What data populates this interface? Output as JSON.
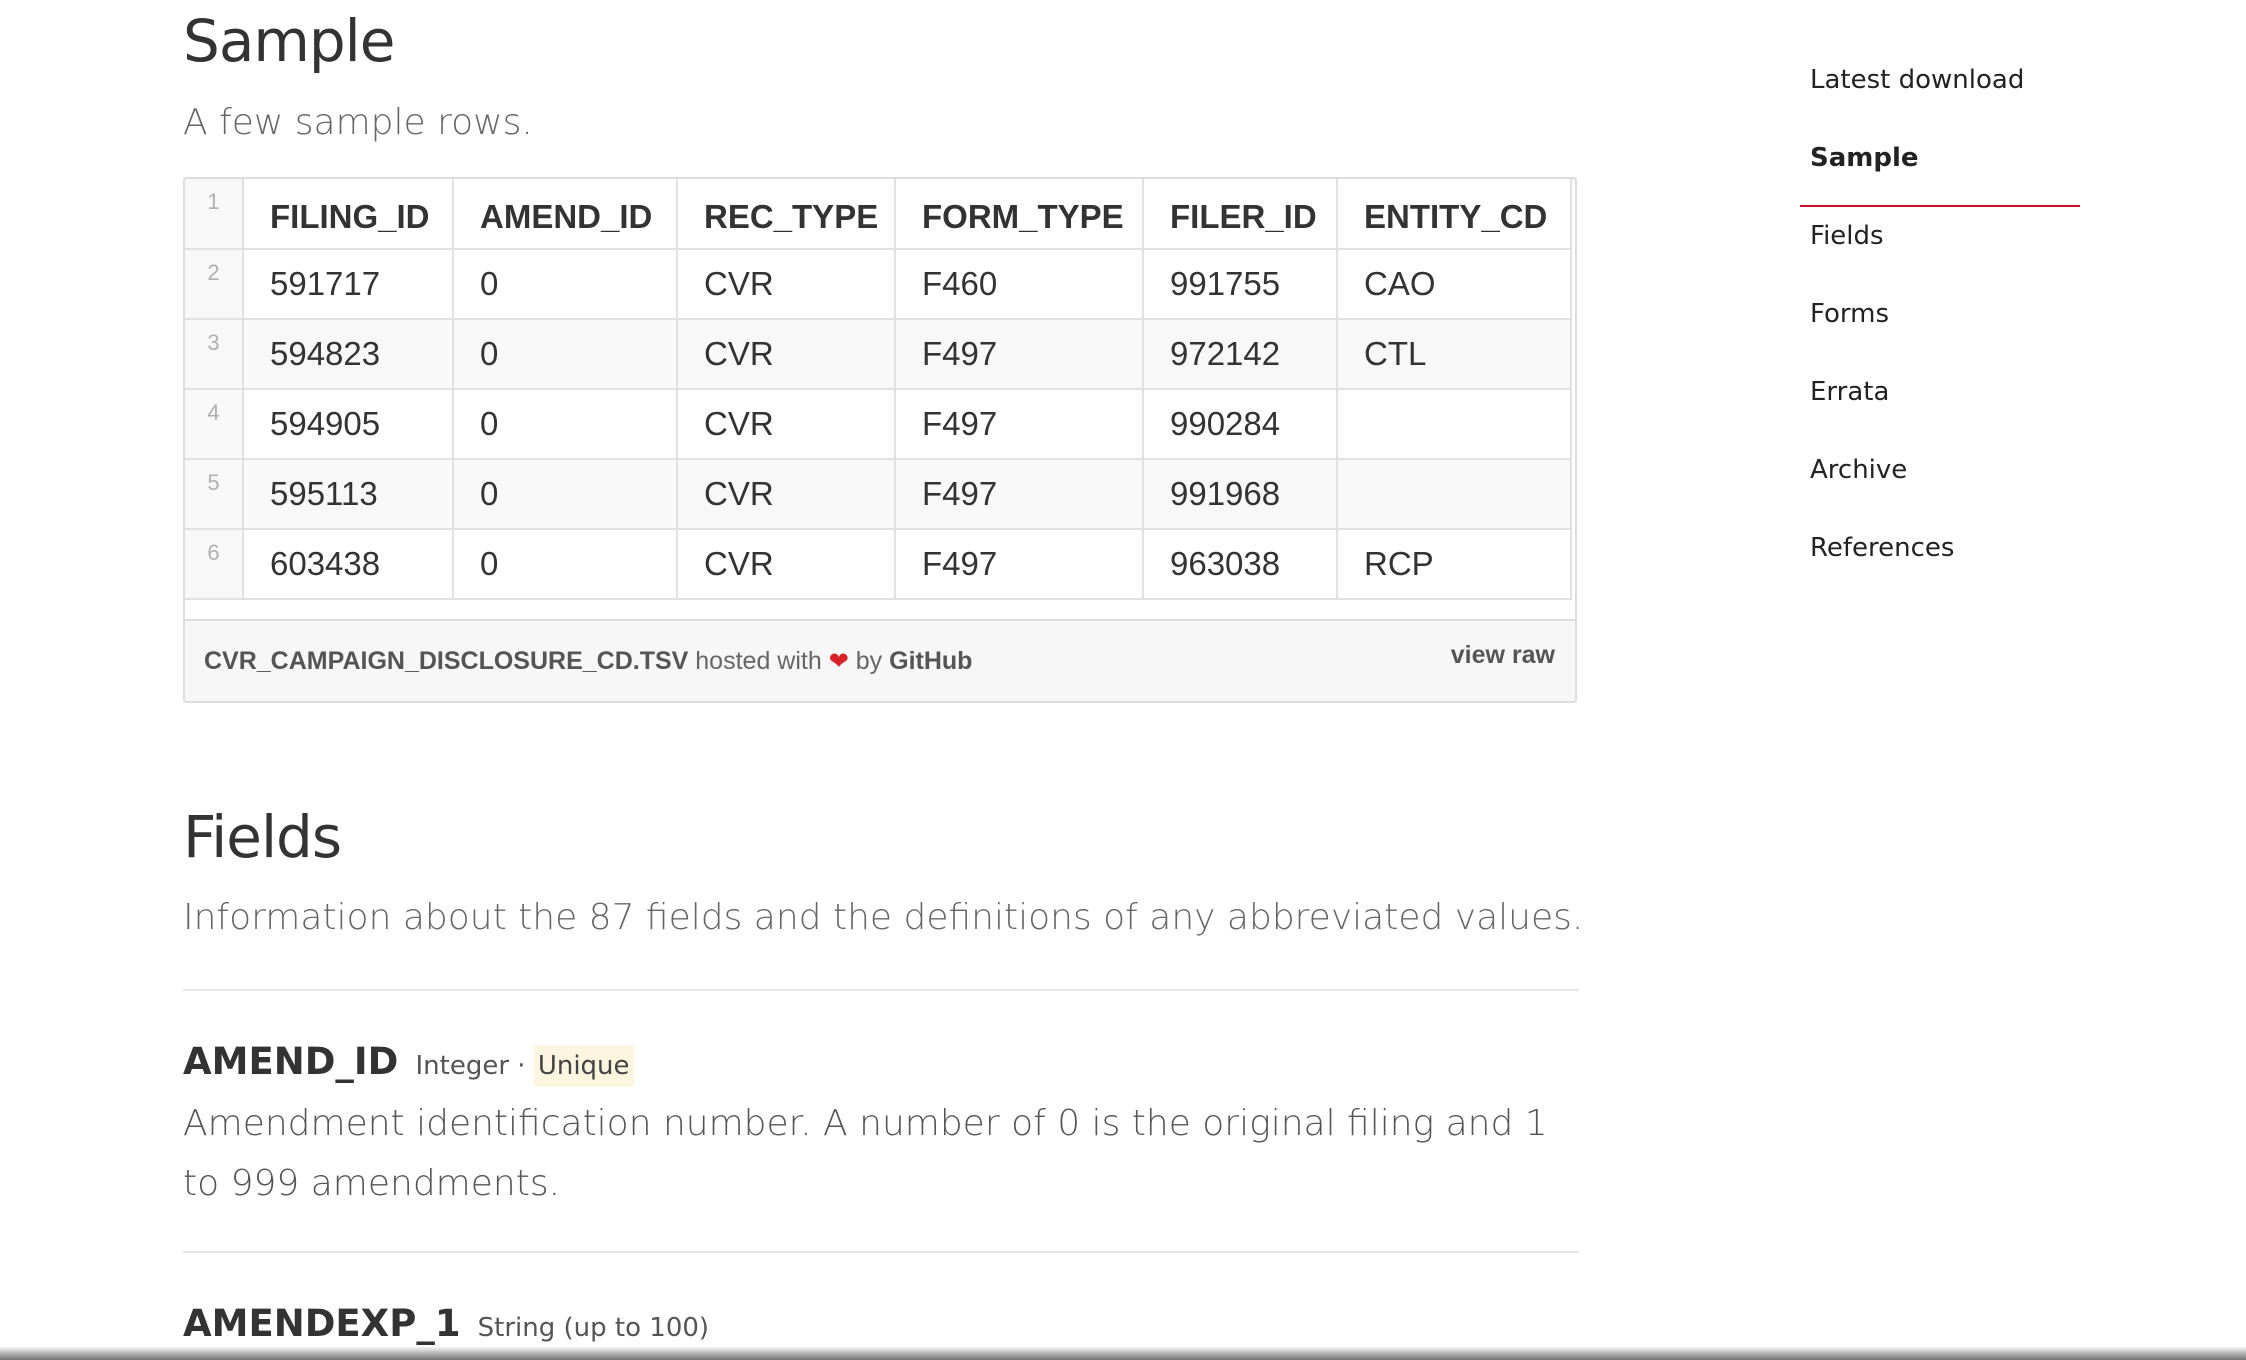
{
  "sample": {
    "title": "Sample",
    "lede": "A few sample rows."
  },
  "gist": {
    "line_numbers": [
      "1",
      "2",
      "3",
      "4",
      "5",
      "6"
    ],
    "headers": [
      "FILING_ID",
      "AMEND_ID",
      "REC_TYPE",
      "FORM_TYPE",
      "FILER_ID",
      "ENTITY_CD"
    ],
    "rows": [
      [
        "591717",
        "0",
        "CVR",
        "F460",
        "991755",
        "CAO"
      ],
      [
        "594823",
        "0",
        "CVR",
        "F497",
        "972142",
        "CTL"
      ],
      [
        "594905",
        "0",
        "CVR",
        "F497",
        "990284",
        ""
      ],
      [
        "595113",
        "0",
        "CVR",
        "F497",
        "991968",
        ""
      ],
      [
        "603438",
        "0",
        "CVR",
        "F497",
        "963038",
        "RCP"
      ]
    ],
    "file_name": "CVR_CAMPAIGN_DISCLOSURE_CD.TSV",
    "hosted_with": "hosted with",
    "heart": "❤",
    "by": "by",
    "provider": "GitHub",
    "view_raw": "view raw"
  },
  "fields": {
    "title": "Fields",
    "lede": "Information about the 87 fields and the definitions of any abbreviated values.",
    "items": [
      {
        "name": "AMEND_ID",
        "type": "Integer",
        "separator": "·",
        "badge": "Unique",
        "description": "Amendment identification number. A number of 0 is the original filing and 1 to 999 amendments."
      },
      {
        "name": "AMENDEXP_1",
        "type": "String (up to 100)"
      }
    ]
  },
  "nav": {
    "items": [
      {
        "label": "Latest download",
        "active": false
      },
      {
        "label": "Sample",
        "active": true
      },
      {
        "label": "Fields",
        "active": false
      },
      {
        "label": "Forms",
        "active": false
      },
      {
        "label": "Errata",
        "active": false
      },
      {
        "label": "Archive",
        "active": false
      },
      {
        "label": "References",
        "active": false
      }
    ],
    "accent_color": "#c8102e"
  }
}
